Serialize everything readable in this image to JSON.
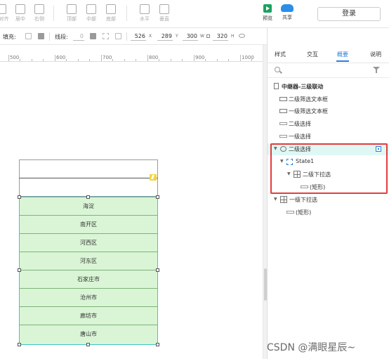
{
  "toolbar": {
    "left_buttons": [
      {
        "label": "左对齐",
        "icon": "align-left-icon"
      },
      {
        "label": "居中",
        "icon": "align-center-icon"
      },
      {
        "label": "右侧",
        "icon": "align-right-icon"
      },
      {
        "label": "顶部",
        "icon": "align-top-icon"
      },
      {
        "label": "中部",
        "icon": "align-middle-icon"
      },
      {
        "label": "底部",
        "icon": "align-bottom-icon"
      },
      {
        "label": "水平",
        "icon": "distribute-horizontal-icon"
      },
      {
        "label": "垂直",
        "icon": "distribute-vertical-icon"
      }
    ],
    "preview_label": "预览",
    "share_label": "共享",
    "login_label": "登录"
  },
  "propbar": {
    "fill_label": "填充:",
    "stroke_label": "线段:",
    "stroke_width": "0",
    "x": "526",
    "x_unit": "X",
    "y": "289",
    "y_unit": "Y",
    "w": "300",
    "w_unit": "W",
    "h": "320",
    "h_unit": "H"
  },
  "ruler": {
    "labels": [
      "500",
      "600",
      "700",
      "800",
      "900",
      "1000"
    ]
  },
  "dropdown_items": [
    "海淀",
    "南开区",
    "河西区",
    "河东区",
    "石家庄市",
    "沧州市",
    "廊坊市",
    "唐山市"
  ],
  "right_panel": {
    "tabs": [
      "样式",
      "交互",
      "概要",
      "说明"
    ],
    "active_tab": "概要",
    "outline": [
      {
        "label": "中继器-三级联动",
        "icon": "page-icon"
      },
      {
        "label": "二级筛选文本框",
        "icon": "textbox-icon"
      },
      {
        "label": "一级筛选文本框",
        "icon": "textbox-icon"
      },
      {
        "label": "二级选择",
        "icon": "line-icon"
      },
      {
        "label": "一级选择",
        "icon": "line-icon"
      },
      {
        "label": "二级选择",
        "icon": "layer-icon"
      },
      {
        "label": "State1",
        "icon": "state-icon"
      },
      {
        "label": "二级下拉选",
        "icon": "dynamic-panel-icon"
      },
      {
        "label": "(矩形)",
        "icon": "line-icon"
      },
      {
        "label": "一级下拉选",
        "icon": "dynamic-panel-icon"
      },
      {
        "label": "(矩形)",
        "icon": "line-icon"
      }
    ]
  },
  "watermark": "CSDN @满眼星辰~"
}
